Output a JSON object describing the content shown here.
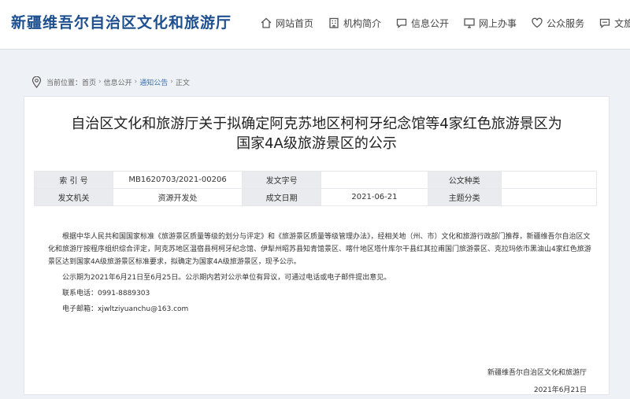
{
  "header": {
    "site_title": "新疆维吾尔自治区文化和旅游厅",
    "nav": [
      {
        "label": "网站首页",
        "icon": "home-icon"
      },
      {
        "label": "机构简介",
        "icon": "building-icon"
      },
      {
        "label": "信息公开",
        "icon": "chat-icon"
      },
      {
        "label": "网上办事",
        "icon": "monitor-icon"
      },
      {
        "label": "公众服务",
        "icon": "heart-icon"
      },
      {
        "label": "文旅资讯",
        "icon": "chat-icon"
      }
    ]
  },
  "breadcrumb": {
    "prefix": "当前位置：",
    "items": [
      "首页",
      "信息公开",
      "通知公告",
      "正文"
    ],
    "separator": "›"
  },
  "article": {
    "title_line1": "自治区文化和旅游厅关于拟确定阿克苏地区柯柯牙纪念馆等4家红色旅游景区为",
    "title_line2": "国家4A级旅游景区的公示",
    "meta": {
      "index_label": "索 引 号",
      "index_value": "MB1620703/2021-00206",
      "doc_no_label": "发文字号",
      "doc_no_value": "",
      "doc_type_label": "公文种类",
      "doc_type_value": "",
      "issuer_label": "发文机关",
      "issuer_value": "资源开发处",
      "date_label": "成文日期",
      "date_value": "2021-06-21",
      "topic_label": "主题分类",
      "topic_value": ""
    },
    "paragraph": "根据中华人民共和国国家标准《旅游景区质量等级的划分与评定》和《旅游景区质量等级管理办法》，经相关地（州、市）文化和旅游行政部门推荐，新疆维吾尔自治区文化和旅游厅按程序组织综合评定，阿克苏地区温宿县柯柯牙纪念馆、伊犁州昭苏县知青馆景区、喀什地区塔什库尔干县红其拉甫国门旅游景区、克拉玛依市黑油山4家红色旅游景区达到国家4A级旅游景区标准要求，拟确定为国家4A级旅游景区，现予公示。",
    "period": "公示期为2021年6月21日至6月25日。公示期内若对公示单位有异议，可通过电话或电子邮件提出意见。",
    "phone_label": "联系电话：",
    "phone": "0991-8889303",
    "email_label": "电子邮箱：",
    "email": "xjwltziyuanchu@163.com",
    "signature_org": "新疆维吾尔自治区文化和旅游厅",
    "signature_date": "2021年6月21日"
  }
}
